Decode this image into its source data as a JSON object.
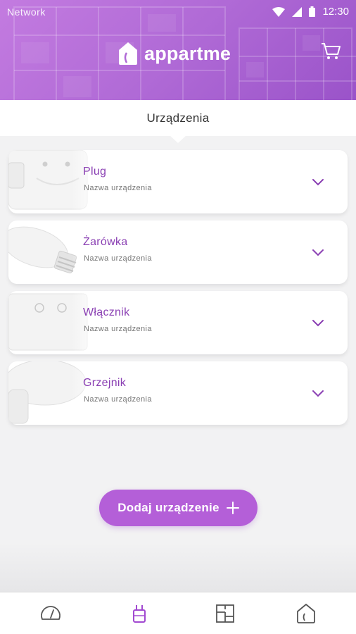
{
  "status_bar": {
    "carrier": "Network",
    "time": "12:30"
  },
  "header": {
    "brand": "appartme",
    "icons": {
      "logo": "house-logo-icon",
      "cart": "cart-icon"
    }
  },
  "page": {
    "title": "Urządzenia"
  },
  "devices": [
    {
      "name": "Plug",
      "subtitle": "Nazwa urządzenia",
      "thumbnail": "plug-image",
      "expand_icon": "chevron-down-icon"
    },
    {
      "name": "Żarówka",
      "subtitle": "Nazwa urządzenia",
      "thumbnail": "bulb-image",
      "expand_icon": "chevron-down-icon"
    },
    {
      "name": "Włącznik",
      "subtitle": "Nazwa urządzenia",
      "thumbnail": "switch-image",
      "expand_icon": "chevron-down-icon"
    },
    {
      "name": "Grzejnik",
      "subtitle": "Nazwa urządzenia",
      "thumbnail": "radiator-thermostat-image",
      "expand_icon": "chevron-down-icon"
    }
  ],
  "add_button": {
    "label": "Dodaj urządzenie",
    "icon": "plus-icon"
  },
  "bottom_nav": [
    {
      "icon": "gauge-icon",
      "active": false
    },
    {
      "icon": "plug-device-icon",
      "active": true
    },
    {
      "icon": "floorplan-icon",
      "active": false
    },
    {
      "icon": "home-icon",
      "active": false
    }
  ],
  "colors": {
    "accent": "#b45fd8",
    "device_name": "#8a3fb3",
    "header_gradient_start": "#c37be0",
    "header_gradient_end": "#9a53c9",
    "background": "#f2f2f3"
  }
}
